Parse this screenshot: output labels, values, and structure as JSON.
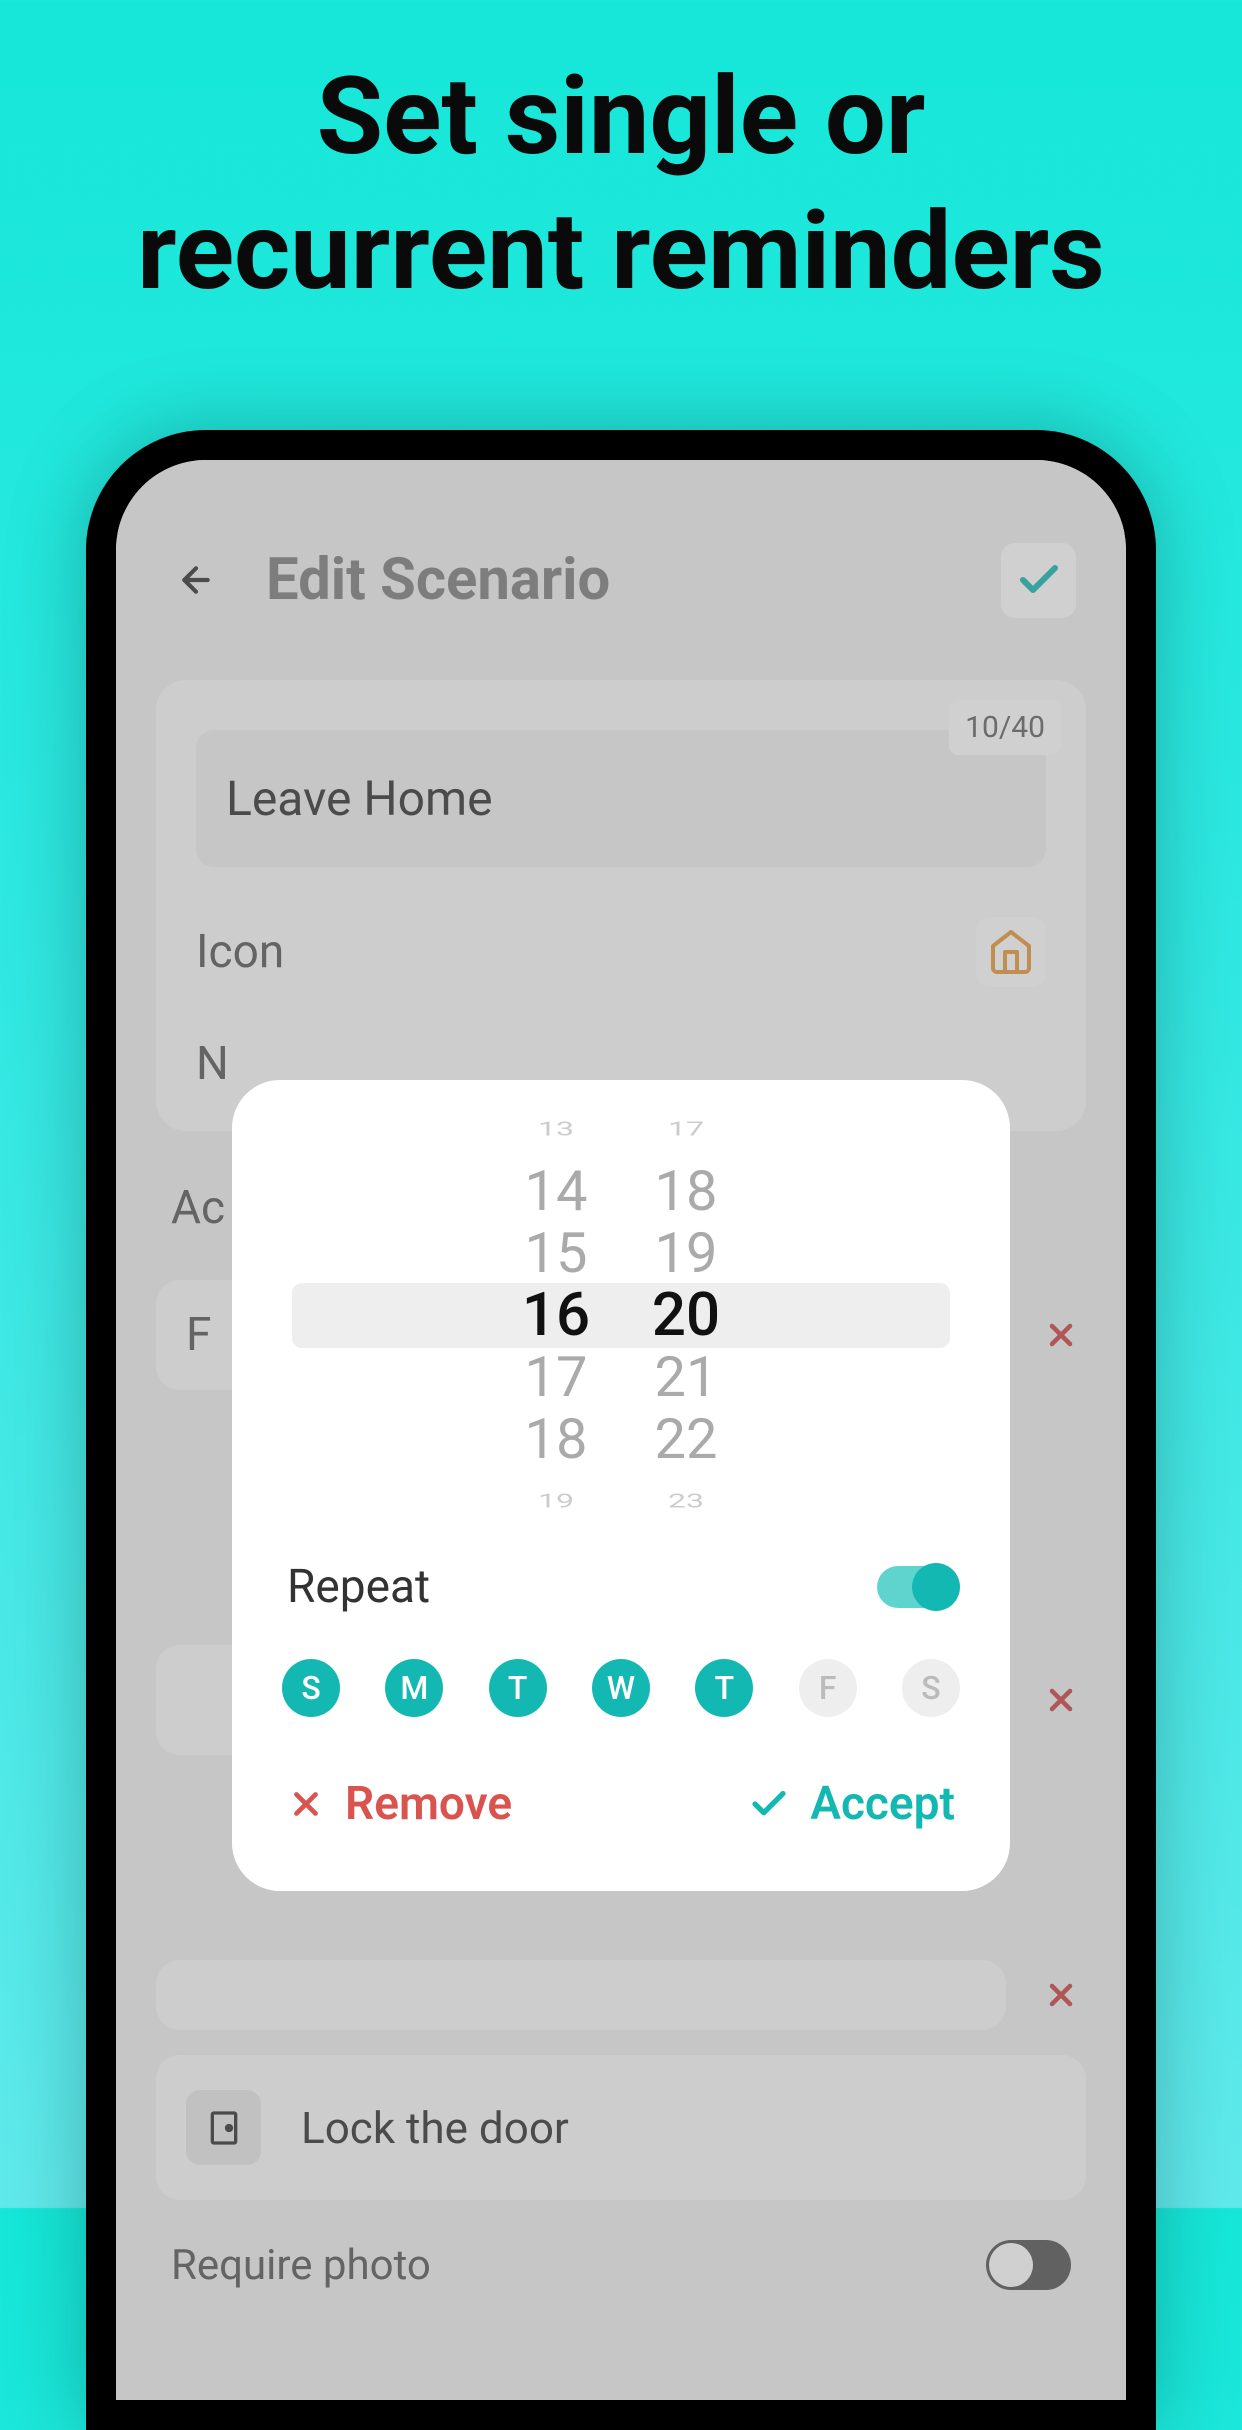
{
  "promo": {
    "line1": "Set single or",
    "line2": "recurrent reminders"
  },
  "header": {
    "title": "Edit Scenario"
  },
  "scenario": {
    "name": "Leave Home",
    "name_counter": "10/40",
    "icon_label": "Icon",
    "next_label": "N",
    "actions_label": "Ac",
    "action1_partial_label": "F",
    "action2_text": "Lock the door",
    "require_photo_label": "Require photo"
  },
  "modal": {
    "time": {
      "hours": [
        "13",
        "14",
        "15",
        "16",
        "17",
        "18",
        "19"
      ],
      "minutes": [
        "17",
        "18",
        "19",
        "20",
        "21",
        "22",
        "23"
      ],
      "selected_hour_index": 3,
      "selected_minute_index": 3
    },
    "repeat_label": "Repeat",
    "repeat_on": true,
    "days": [
      {
        "label": "S",
        "active": true
      },
      {
        "label": "M",
        "active": true
      },
      {
        "label": "T",
        "active": true
      },
      {
        "label": "W",
        "active": true
      },
      {
        "label": "T",
        "active": true
      },
      {
        "label": "F",
        "active": false
      },
      {
        "label": "S",
        "active": false
      }
    ],
    "remove_label": "Remove",
    "accept_label": "Accept"
  }
}
